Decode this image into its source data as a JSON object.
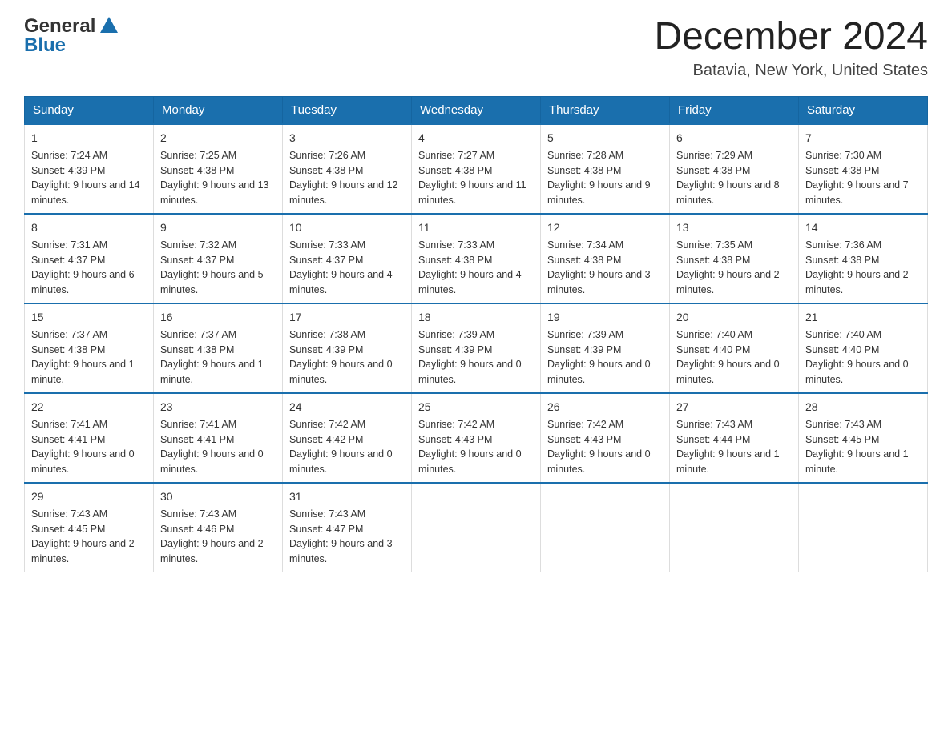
{
  "logo": {
    "text_general": "General",
    "text_blue": "Blue"
  },
  "header": {
    "title": "December 2024",
    "subtitle": "Batavia, New York, United States"
  },
  "days_of_week": [
    "Sunday",
    "Monday",
    "Tuesday",
    "Wednesday",
    "Thursday",
    "Friday",
    "Saturday"
  ],
  "weeks": [
    [
      {
        "day": "1",
        "sunrise": "7:24 AM",
        "sunset": "4:39 PM",
        "daylight": "9 hours and 14 minutes."
      },
      {
        "day": "2",
        "sunrise": "7:25 AM",
        "sunset": "4:38 PM",
        "daylight": "9 hours and 13 minutes."
      },
      {
        "day": "3",
        "sunrise": "7:26 AM",
        "sunset": "4:38 PM",
        "daylight": "9 hours and 12 minutes."
      },
      {
        "day": "4",
        "sunrise": "7:27 AM",
        "sunset": "4:38 PM",
        "daylight": "9 hours and 11 minutes."
      },
      {
        "day": "5",
        "sunrise": "7:28 AM",
        "sunset": "4:38 PM",
        "daylight": "9 hours and 9 minutes."
      },
      {
        "day": "6",
        "sunrise": "7:29 AM",
        "sunset": "4:38 PM",
        "daylight": "9 hours and 8 minutes."
      },
      {
        "day": "7",
        "sunrise": "7:30 AM",
        "sunset": "4:38 PM",
        "daylight": "9 hours and 7 minutes."
      }
    ],
    [
      {
        "day": "8",
        "sunrise": "7:31 AM",
        "sunset": "4:37 PM",
        "daylight": "9 hours and 6 minutes."
      },
      {
        "day": "9",
        "sunrise": "7:32 AM",
        "sunset": "4:37 PM",
        "daylight": "9 hours and 5 minutes."
      },
      {
        "day": "10",
        "sunrise": "7:33 AM",
        "sunset": "4:37 PM",
        "daylight": "9 hours and 4 minutes."
      },
      {
        "day": "11",
        "sunrise": "7:33 AM",
        "sunset": "4:38 PM",
        "daylight": "9 hours and 4 minutes."
      },
      {
        "day": "12",
        "sunrise": "7:34 AM",
        "sunset": "4:38 PM",
        "daylight": "9 hours and 3 minutes."
      },
      {
        "day": "13",
        "sunrise": "7:35 AM",
        "sunset": "4:38 PM",
        "daylight": "9 hours and 2 minutes."
      },
      {
        "day": "14",
        "sunrise": "7:36 AM",
        "sunset": "4:38 PM",
        "daylight": "9 hours and 2 minutes."
      }
    ],
    [
      {
        "day": "15",
        "sunrise": "7:37 AM",
        "sunset": "4:38 PM",
        "daylight": "9 hours and 1 minute."
      },
      {
        "day": "16",
        "sunrise": "7:37 AM",
        "sunset": "4:38 PM",
        "daylight": "9 hours and 1 minute."
      },
      {
        "day": "17",
        "sunrise": "7:38 AM",
        "sunset": "4:39 PM",
        "daylight": "9 hours and 0 minutes."
      },
      {
        "day": "18",
        "sunrise": "7:39 AM",
        "sunset": "4:39 PM",
        "daylight": "9 hours and 0 minutes."
      },
      {
        "day": "19",
        "sunrise": "7:39 AM",
        "sunset": "4:39 PM",
        "daylight": "9 hours and 0 minutes."
      },
      {
        "day": "20",
        "sunrise": "7:40 AM",
        "sunset": "4:40 PM",
        "daylight": "9 hours and 0 minutes."
      },
      {
        "day": "21",
        "sunrise": "7:40 AM",
        "sunset": "4:40 PM",
        "daylight": "9 hours and 0 minutes."
      }
    ],
    [
      {
        "day": "22",
        "sunrise": "7:41 AM",
        "sunset": "4:41 PM",
        "daylight": "9 hours and 0 minutes."
      },
      {
        "day": "23",
        "sunrise": "7:41 AM",
        "sunset": "4:41 PM",
        "daylight": "9 hours and 0 minutes."
      },
      {
        "day": "24",
        "sunrise": "7:42 AM",
        "sunset": "4:42 PM",
        "daylight": "9 hours and 0 minutes."
      },
      {
        "day": "25",
        "sunrise": "7:42 AM",
        "sunset": "4:43 PM",
        "daylight": "9 hours and 0 minutes."
      },
      {
        "day": "26",
        "sunrise": "7:42 AM",
        "sunset": "4:43 PM",
        "daylight": "9 hours and 0 minutes."
      },
      {
        "day": "27",
        "sunrise": "7:43 AM",
        "sunset": "4:44 PM",
        "daylight": "9 hours and 1 minute."
      },
      {
        "day": "28",
        "sunrise": "7:43 AM",
        "sunset": "4:45 PM",
        "daylight": "9 hours and 1 minute."
      }
    ],
    [
      {
        "day": "29",
        "sunrise": "7:43 AM",
        "sunset": "4:45 PM",
        "daylight": "9 hours and 2 minutes."
      },
      {
        "day": "30",
        "sunrise": "7:43 AM",
        "sunset": "4:46 PM",
        "daylight": "9 hours and 2 minutes."
      },
      {
        "day": "31",
        "sunrise": "7:43 AM",
        "sunset": "4:47 PM",
        "daylight": "9 hours and 3 minutes."
      },
      null,
      null,
      null,
      null
    ]
  ]
}
